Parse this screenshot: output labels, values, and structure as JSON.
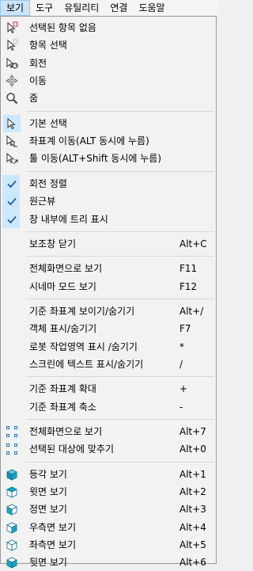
{
  "menubar": [
    "보기",
    "도구",
    "유틸리티",
    "연결",
    "도움말"
  ],
  "groups": [
    {
      "items": [
        {
          "label": "선택된 항목 없음",
          "icon": "select-none-icon"
        },
        {
          "label": "항목 선택",
          "icon": "select-item-icon"
        },
        {
          "label": "회전",
          "icon": "rotate-icon"
        },
        {
          "label": "이동",
          "icon": "move-icon"
        },
        {
          "label": "줌",
          "icon": "zoom-icon"
        }
      ]
    },
    {
      "items": [
        {
          "label": "기본 선택",
          "icon": "basic-select-icon",
          "checked": true
        },
        {
          "label": "좌표계 이동(ALT 동시에 누름)",
          "icon": "frame-move-icon"
        },
        {
          "label": "툴 이동(ALT+Shift 동시에 누름)",
          "icon": "tool-move-icon"
        }
      ]
    },
    {
      "items": [
        {
          "label": "회전 정렬",
          "icon": "check-icon",
          "checked": true
        },
        {
          "label": "원근뷰",
          "icon": "check-icon",
          "checked": true
        },
        {
          "label": "창 내부에 트리 표시",
          "icon": "check-icon",
          "checked": true
        }
      ]
    },
    {
      "items": [
        {
          "label": "보조창 닫기",
          "shortcut": "Alt+C"
        }
      ]
    },
    {
      "items": [
        {
          "label": "전체화면으로 보기",
          "shortcut": "F11"
        },
        {
          "label": "시네마 모드 보기",
          "shortcut": "F12"
        }
      ]
    },
    {
      "items": [
        {
          "label": "기준 좌표계 보이기/숨기기",
          "shortcut": "Alt+/"
        },
        {
          "label": "객체 표시/숨기기",
          "shortcut": "F7"
        },
        {
          "label": "로봇 작업영역 표시 /숨기기",
          "shortcut": "*"
        },
        {
          "label": "스크린에 텍스트 표시/숨기기",
          "shortcut": "/"
        }
      ]
    },
    {
      "items": [
        {
          "label": "기준 좌표계 확대",
          "shortcut": "+"
        },
        {
          "label": "기준 좌표계 축소",
          "shortcut": "-"
        }
      ]
    },
    {
      "items": [
        {
          "label": "전체화면으로 보기",
          "shortcut": "Alt+7",
          "icon": "fit-all-icon"
        },
        {
          "label": "선택된 대상에 맞추기",
          "shortcut": "Alt+0",
          "icon": "fit-selection-icon"
        }
      ]
    },
    {
      "items": [
        {
          "label": "등각 보기",
          "shortcut": "Alt+1",
          "icon": "iso-view-icon"
        },
        {
          "label": "윗면 보기",
          "shortcut": "Alt+2",
          "icon": "top-view-icon"
        },
        {
          "label": "정면 보기",
          "shortcut": "Alt+3",
          "icon": "front-view-icon"
        },
        {
          "label": "우측면 보기",
          "shortcut": "Alt+4",
          "icon": "right-view-icon"
        },
        {
          "label": "좌측면 보기",
          "shortcut": "Alt+5",
          "icon": "left-view-icon"
        },
        {
          "label": "뒷면 보기",
          "shortcut": "Alt+6",
          "icon": "back-view-icon"
        }
      ]
    }
  ],
  "colors": {
    "accent": "#0078d7",
    "checked_bg": "#cce8ff",
    "cube": "#1aa3c8"
  }
}
